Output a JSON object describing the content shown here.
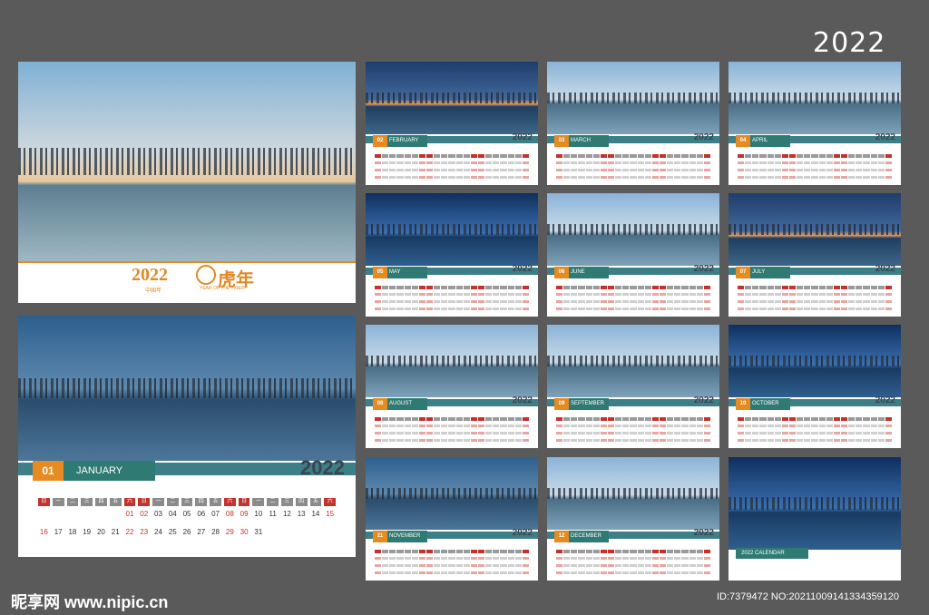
{
  "year_badge": "2022",
  "cover": {
    "title": "2022",
    "title_zh": "虎年",
    "subtitle_zh": "中国年",
    "subtitle_en": "YEAR OF THE TIGER"
  },
  "january": {
    "num": "01",
    "name": "JANUARY",
    "year": "2022",
    "weekdays": [
      "日",
      "一",
      "二",
      "三",
      "四",
      "五",
      "六",
      "日",
      "一",
      "二",
      "三",
      "四",
      "五",
      "六",
      "日",
      "一",
      "二",
      "三",
      "四",
      "五",
      "六"
    ],
    "row1": [
      "",
      "",
      "",
      "",
      "",
      "",
      "01",
      "02",
      "03",
      "04",
      "05",
      "06",
      "07",
      "08",
      "09",
      "10",
      "11",
      "12",
      "13",
      "14",
      "15"
    ],
    "row2": [
      "16",
      "17",
      "18",
      "19",
      "20",
      "21",
      "22",
      "23",
      "24",
      "25",
      "26",
      "27",
      "28",
      "29",
      "30",
      "31",
      "",
      "",
      "",
      "",
      ""
    ]
  },
  "months": [
    {
      "num": "02",
      "name": "FEBRUARY",
      "year": "2022"
    },
    {
      "num": "03",
      "name": "MARCH",
      "year": "2022"
    },
    {
      "num": "04",
      "name": "APRIL",
      "year": "2022"
    },
    {
      "num": "05",
      "name": "MAY",
      "year": "2022"
    },
    {
      "num": "06",
      "name": "JUNE",
      "year": "2022"
    },
    {
      "num": "07",
      "name": "JULY",
      "year": "2022"
    },
    {
      "num": "08",
      "name": "AUGUST",
      "year": "2022"
    },
    {
      "num": "09",
      "name": "SEPTEMBER",
      "year": "2022"
    },
    {
      "num": "10",
      "name": "OCTOBER",
      "year": "2022"
    },
    {
      "num": "11",
      "name": "NOVEMBER",
      "year": "2022"
    },
    {
      "num": "12",
      "name": "DECEMBER",
      "year": "2022"
    }
  ],
  "calendar_label": "2022 CALENDAR",
  "watermark_left": "昵享网 www.nipic.cn",
  "watermark_right": "ID:7379472 NO:20211009141334359120",
  "colors": {
    "teal": "#2f7a73",
    "orange": "#e58b22",
    "red": "#c3332e",
    "background": "#5a5a5a"
  }
}
